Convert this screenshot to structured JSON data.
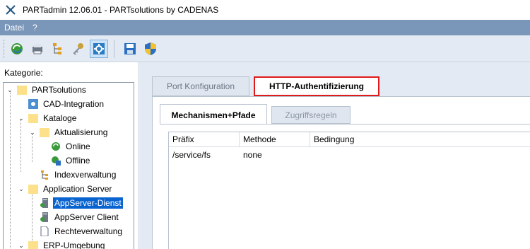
{
  "window": {
    "title": "PARTadmin 12.06.01 - PARTsolutions by CADENAS"
  },
  "menu": {
    "items": [
      "Datei",
      "?"
    ]
  },
  "toolbar": {
    "buttons": [
      "refresh-icon",
      "printer-icon",
      "tree-hierarchy-icon",
      "keys-icon",
      "settings-gear-icon",
      "save-icon",
      "shield-icon"
    ]
  },
  "sidebar": {
    "label": "Kategorie:",
    "tree": [
      {
        "label": "PARTsolutions",
        "icon": "folder-icon",
        "level": 0,
        "expanded": true
      },
      {
        "label": "CAD-Integration",
        "icon": "cad-integration-icon",
        "level": 1
      },
      {
        "label": "Kataloge",
        "icon": "folder-icon",
        "level": 1,
        "expanded": true
      },
      {
        "label": "Aktualisierung",
        "icon": "folder-icon",
        "level": 2,
        "expanded": true
      },
      {
        "label": "Online",
        "icon": "online-update-icon",
        "level": 3
      },
      {
        "label": "Offline",
        "icon": "offline-update-icon",
        "level": 3
      },
      {
        "label": "Indexverwaltung",
        "icon": "index-icon",
        "level": 2
      },
      {
        "label": "Application Server",
        "icon": "folder-icon",
        "level": 1,
        "expanded": true
      },
      {
        "label": "AppServer-Dienst",
        "icon": "server-icon",
        "level": 2,
        "selected": true
      },
      {
        "label": "AppServer Client",
        "icon": "server-icon",
        "level": 2
      },
      {
        "label": "Rechteverwaltung",
        "icon": "document-icon",
        "level": 2
      },
      {
        "label": "ERP-Umgebung",
        "icon": "folder-icon",
        "level": 1,
        "expanded": true
      }
    ]
  },
  "tabs": {
    "outer": [
      {
        "label": "Port Konfiguration",
        "active": false
      },
      {
        "label": "HTTP-Authentifizierung",
        "active": true
      }
    ],
    "inner": [
      {
        "label": "Mechanismen+Pfade",
        "active": true
      },
      {
        "label": "Zugriffsregeln",
        "active": false
      }
    ]
  },
  "table": {
    "columns": [
      "Präfix",
      "Methode",
      "Bedingung"
    ],
    "rows": [
      [
        "/service/fs",
        "none",
        ""
      ]
    ]
  },
  "colors": {
    "menubar": "#7a96b8",
    "highlight_border": "#e01a1a",
    "selection": "#0a64d0",
    "panel_bg": "#e3eaf3"
  }
}
